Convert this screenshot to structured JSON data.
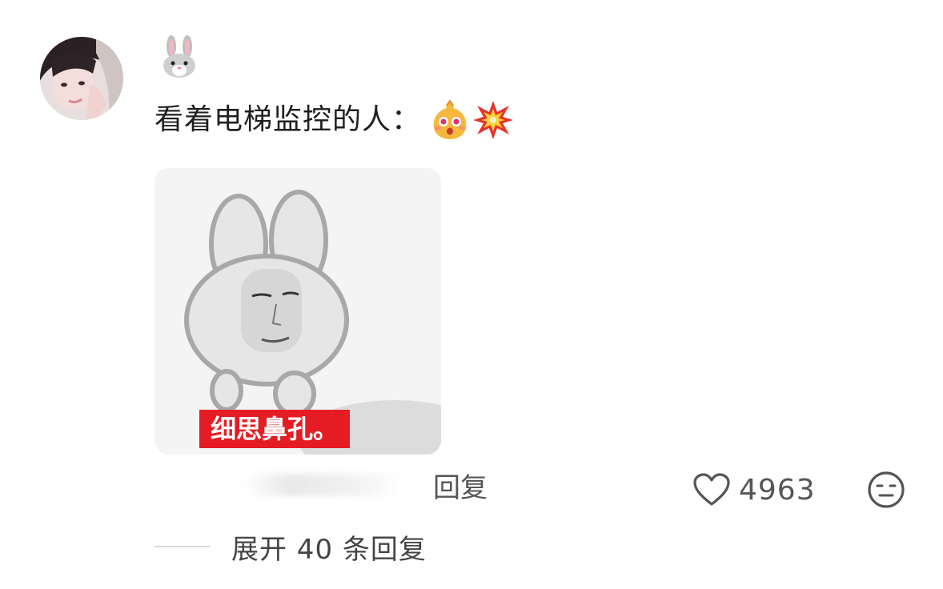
{
  "comment": {
    "username_emoji": "rabbit-face",
    "text": "看着电梯监控的人：",
    "stickers": [
      "surprised-face-sticker",
      "collision-sticker"
    ],
    "image": {
      "caption": "细思鼻孔。"
    },
    "reply_label": "回复",
    "like_count": "4963",
    "expand_label": "展开 40 条回复"
  }
}
